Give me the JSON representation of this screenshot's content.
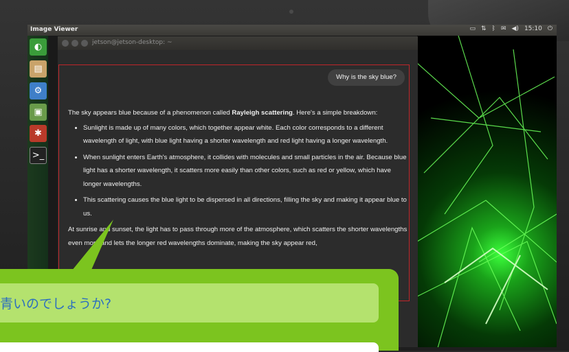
{
  "topbar": {
    "app_title": "Image Viewer",
    "clock": "15:10",
    "tray_icons": [
      "keyboard-icon",
      "network-icon",
      "bluetooth-icon",
      "mail-icon",
      "volume-icon",
      "power-icon"
    ]
  },
  "launcher": {
    "items": [
      "dash-home-icon",
      "files-icon",
      "settings-icon",
      "image-viewer-icon",
      "system-tools-icon",
      "terminal-icon"
    ]
  },
  "terminal": {
    "title": "jetson@jetson-desktop: ~"
  },
  "chat": {
    "user_message": "Why is the sky blue?",
    "answer_intro_before": "The sky appears blue because of a phenomenon called ",
    "answer_intro_bold": "Rayleigh scattering",
    "answer_intro_after": ". Here's a simple breakdown:",
    "bullets": [
      "Sunlight is made up of many colors, which together appear white. Each color corresponds to a different wavelength of light, with blue light having a shorter wavelength and red light having a longer wavelength.",
      "When sunlight enters Earth's atmosphere, it collides with molecules and small particles in the air. Because blue light has a shorter wavelength, it scatters more easily than other colors, such as red or yellow, which have longer wavelengths.",
      "This scattering causes the blue light to be dispersed in all directions, filling the sky and making it appear blue to us."
    ],
    "closing": "At sunrise and sunset, the light has to pass through more of the atmosphere, which scatters the shorter wavelengths even more and lets the longer red wavelengths dominate, making the sky appear red,"
  },
  "overlay": {
    "question_text": "青いのでしょうか?"
  },
  "colors": {
    "chat_border": "#c0262a",
    "overlay_green": "#7cc41f",
    "question_box": "#b4e26e",
    "question_text": "#2c6fbf"
  }
}
